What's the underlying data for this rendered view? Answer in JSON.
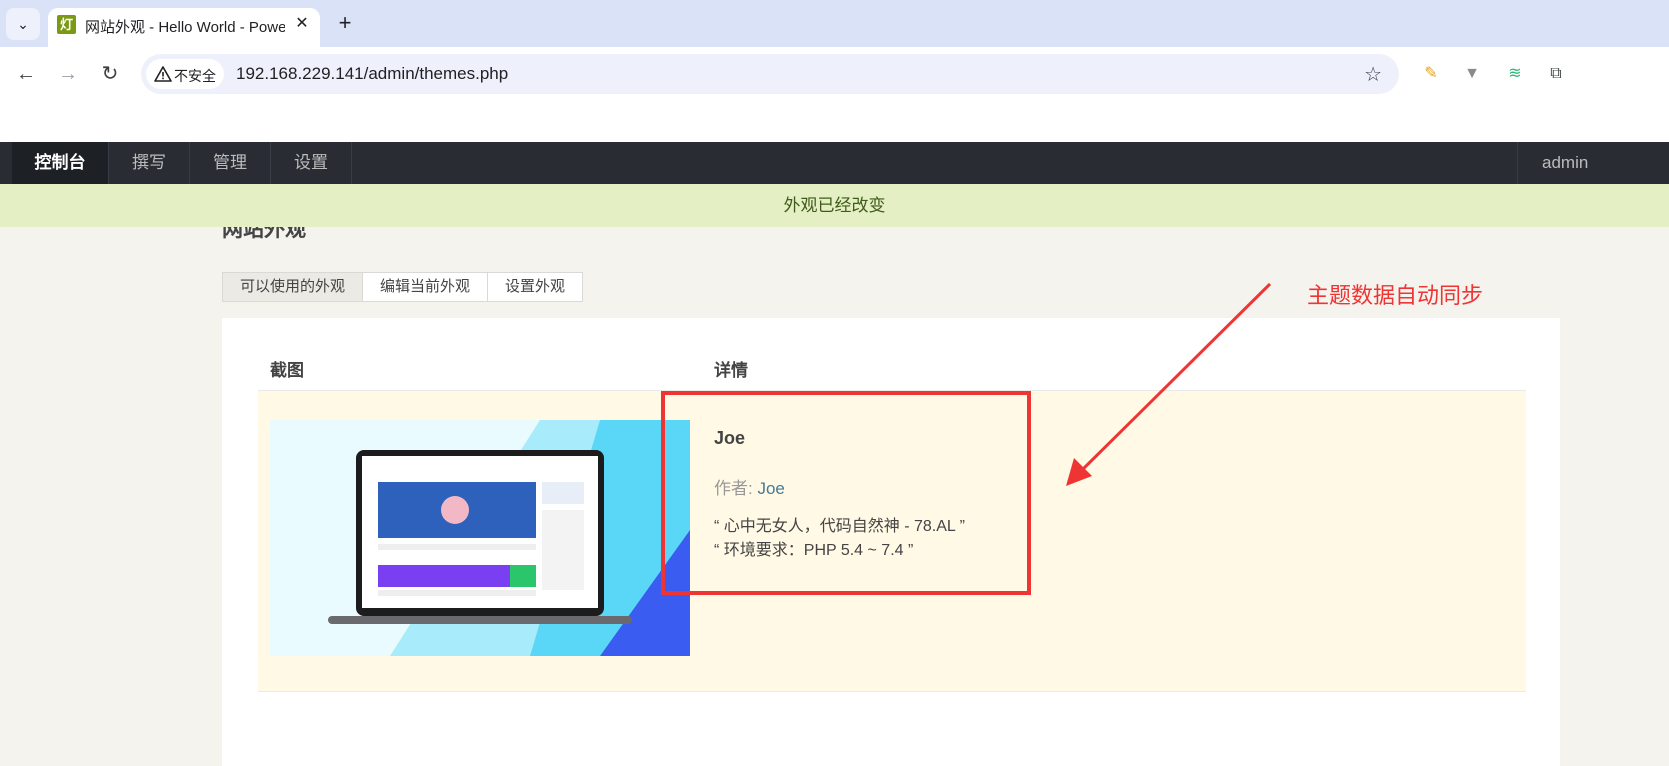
{
  "browser": {
    "tab_title": "网站外观 - Hello World - Powered by Typecho",
    "favicon_char": "灯",
    "security_label": "不安全",
    "url": "192.168.229.141/admin/themes.php",
    "icons": [
      "chevron-down-icon",
      "close-icon",
      "plus-icon",
      "back-icon",
      "forward-icon",
      "reload-icon",
      "warning-icon",
      "star-icon",
      "eyedropper-extension-icon",
      "vue-extension-icon",
      "layers-extension-icon",
      "puzzle-extension-icon"
    ]
  },
  "nav": {
    "items": [
      "控制台",
      "撰写",
      "管理",
      "设置"
    ],
    "user": "admin"
  },
  "notice": "外观已经改变",
  "page": {
    "title": "网站外观",
    "tabs": [
      "可以使用的外观",
      "编辑当前外观",
      "设置外观"
    ]
  },
  "table": {
    "headers": [
      "截图",
      "详情"
    ],
    "theme": {
      "name": "Joe",
      "author_label": "作者:",
      "author": "Joe",
      "desc_1": "“ 心中无女人，代码自然神 - 78.AL ”",
      "desc_2": "“ 环境要求：PHP 5.4 ~ 7.4 ”"
    }
  },
  "annotation": {
    "text": "主题数据自动同步",
    "color": "#ef3434"
  },
  "colors": {
    "admin_nav": "#292d33",
    "notice_bg": "#e4efc3",
    "row_bg": "#fff9e6",
    "link": "#467b96"
  }
}
